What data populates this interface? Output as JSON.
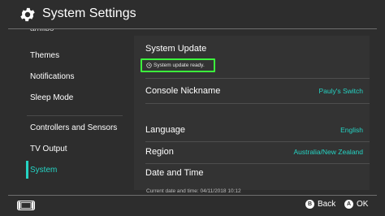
{
  "header": {
    "title": "System Settings",
    "icon": "gear-icon"
  },
  "sidebar": {
    "partial_item": "amiibo",
    "items": [
      {
        "label": "Themes"
      },
      {
        "label": "Notifications"
      },
      {
        "label": "Sleep Mode"
      },
      {
        "label": "Controllers and Sensors"
      },
      {
        "label": "TV Output"
      },
      {
        "label": "System",
        "selected": true
      }
    ]
  },
  "main": {
    "system_update": {
      "label": "System Update",
      "status": "System update ready.",
      "status_icon": "clock-icon"
    },
    "console_nickname": {
      "label": "Console Nickname",
      "value": "Pauly's Switch"
    },
    "language": {
      "label": "Language",
      "value": "English"
    },
    "region": {
      "label": "Region",
      "value": "Australia/New Zealand"
    },
    "date_time": {
      "label": "Date and Time",
      "current": "Current date and time: 04/11/2018 10:12"
    }
  },
  "footer": {
    "console_icon": "console-icon",
    "back": {
      "button": "B",
      "label": "Back"
    },
    "ok": {
      "button": "A",
      "label": "OK"
    }
  },
  "colors": {
    "background": "#2d2d2d",
    "accent": "#25d4c4",
    "highlight": "#3cf43c",
    "text": "#ffffff"
  }
}
